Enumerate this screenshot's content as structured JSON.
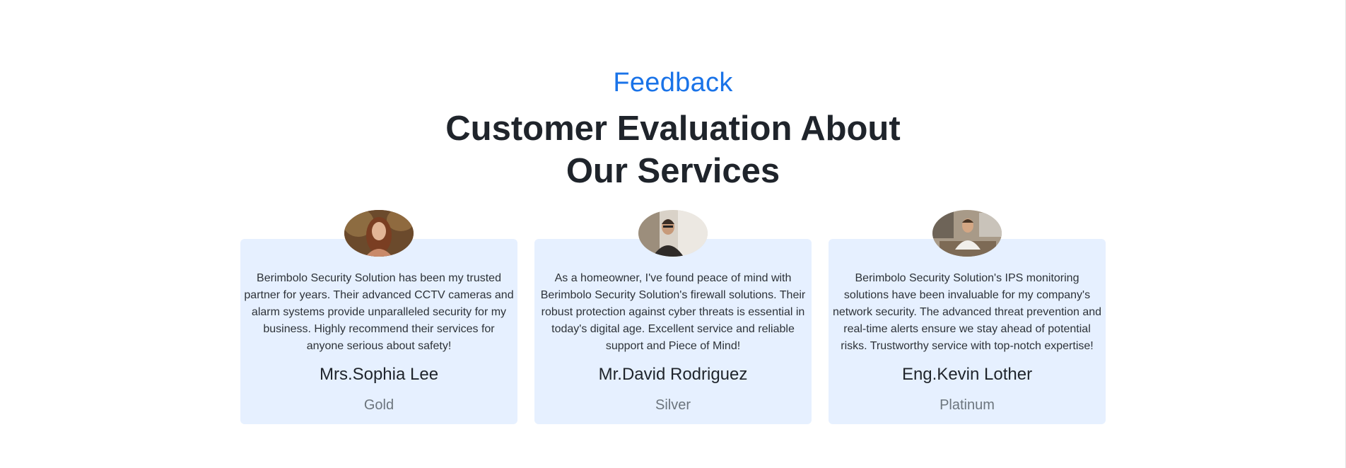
{
  "section": {
    "eyebrow": "Feedback",
    "title_line1": "Customer Evaluation About",
    "title_line2": "Our Services"
  },
  "testimonials": [
    {
      "quote": "Berimbolo Security Solution has been my trusted partner for years. Their advanced CCTV cameras and alarm systems provide unparalleled security for my business. Highly recommend their services for anyone serious about safety!",
      "name": "Mrs.Sophia Lee",
      "tier": "Gold",
      "avatar": "woman-portrait-photo"
    },
    {
      "quote": "As a homeowner, I've found peace of mind with Berimbolo Security Solution's firewall solutions. Their robust protection against cyber threats is essential in today's digital age. Excellent service and reliable support and Piece of Mind!",
      "name": "Mr.David Rodriguez",
      "tier": "Silver",
      "avatar": "man-portrait-photo"
    },
    {
      "quote": "Berimbolo Security Solution's IPS monitoring solutions have been invaluable for my company's network security. The advanced threat prevention and real-time alerts ensure we stay ahead of potential risks. Trustworthy service with top-notch expertise!",
      "name": "Eng.Kevin Lother",
      "tier": "Platinum",
      "avatar": "man-office-portrait-photo"
    }
  ],
  "colors": {
    "accent": "#1a73e8",
    "card_bg": "#e6f0ff",
    "tier_text": "#6c757d"
  }
}
